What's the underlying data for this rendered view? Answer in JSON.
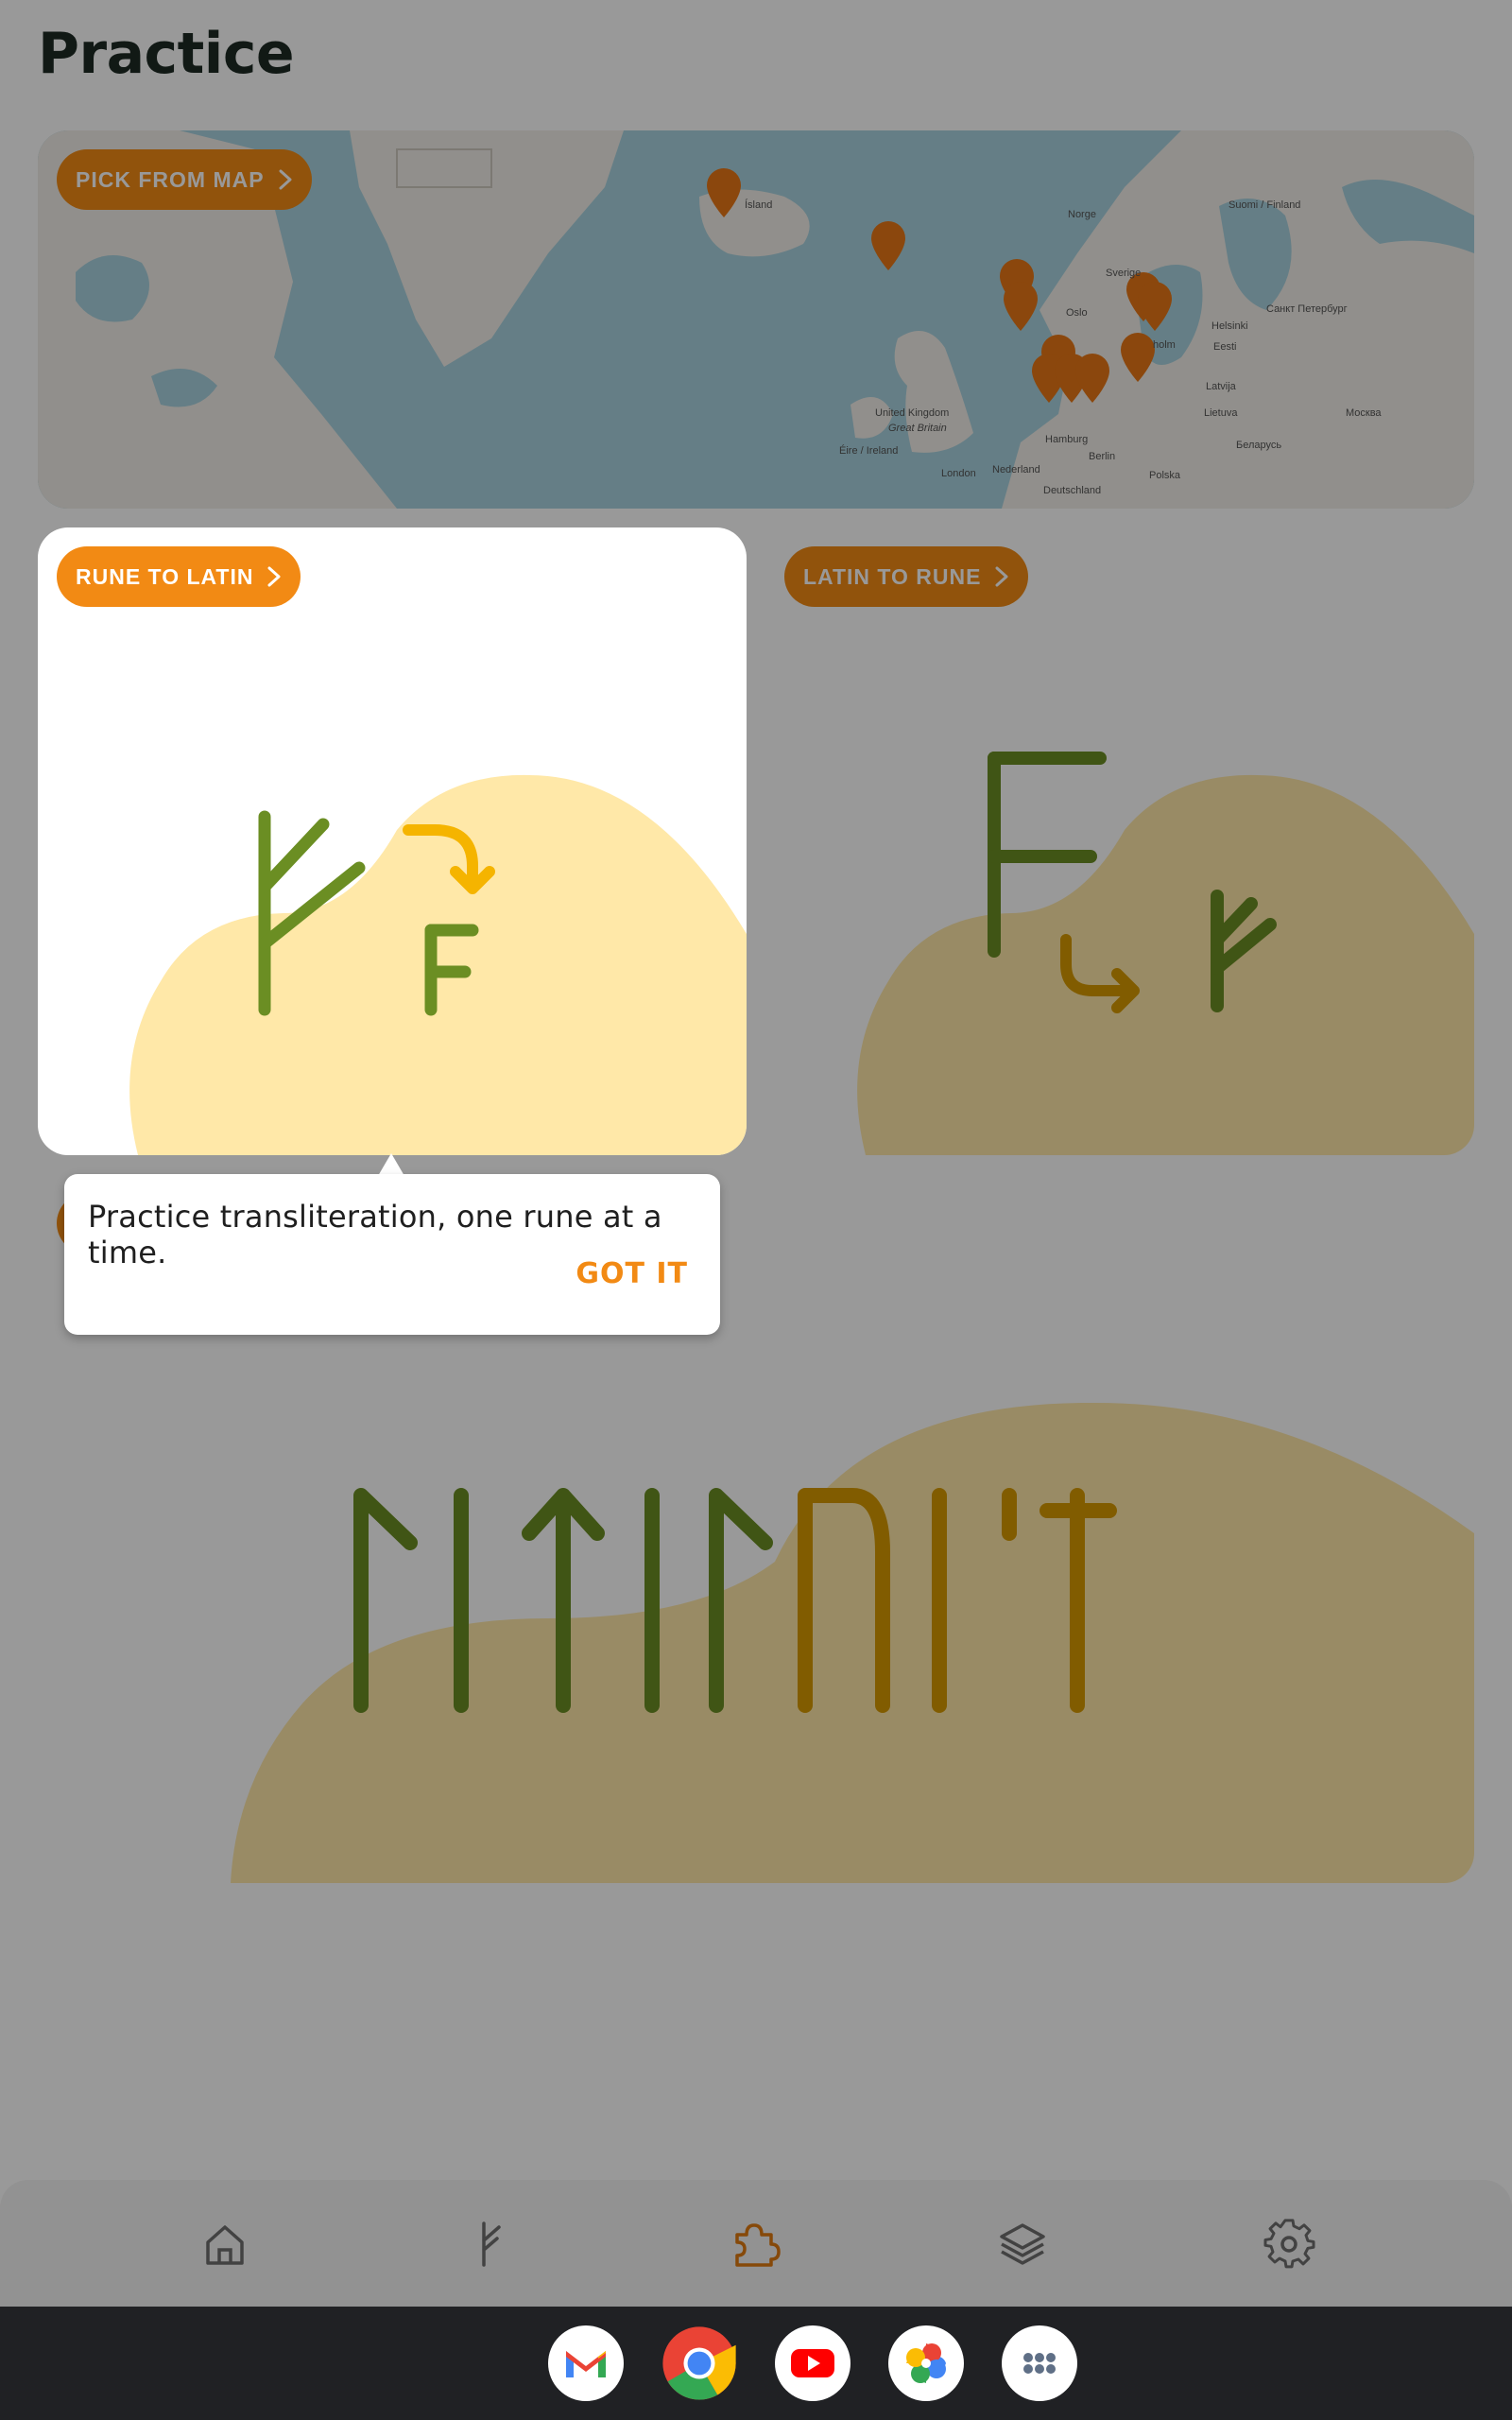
{
  "page": {
    "title": "Practice"
  },
  "map_card": {
    "button_label": "PICK FROM MAP",
    "place_labels": [
      "Ísland",
      "Norge",
      "Sverige",
      "Oslo",
      "Suomi / Finland",
      "Helsinki",
      "Eesti",
      "Latvija",
      "Lietuva",
      "Санкт Петербург",
      "Москва",
      "Беларусь",
      "Polska",
      "Berlin",
      "Hamburg",
      "Deutschland",
      "Nederland",
      "London",
      "United Kingdom",
      "Great Britain",
      "Éire / Ireland",
      "holm"
    ],
    "marker_count": 11,
    "marker_icon": "rune-marker-icon"
  },
  "cards": {
    "rune_to_latin": {
      "label": "RUNE TO LATIN",
      "latin_glyph": "F"
    },
    "latin_to_rune": {
      "label": "LATIN TO RUNE",
      "latin_glyph": "F"
    },
    "words": {
      "glyphs": "ᛚᛁᛏᛁᛚᚢᛁ'ᛏ"
    }
  },
  "tooltip": {
    "text": "Practice transliteration, one rune at a time.",
    "button": "GOT IT"
  },
  "nav": {
    "items": [
      {
        "name": "home",
        "icon": "home-icon",
        "active": false
      },
      {
        "name": "runes",
        "icon": "rune-icon",
        "active": false
      },
      {
        "name": "practice",
        "icon": "puzzle-icon",
        "active": true
      },
      {
        "name": "layers",
        "icon": "layers-icon",
        "active": false
      },
      {
        "name": "settings",
        "icon": "gear-icon",
        "active": false
      }
    ]
  },
  "taskbar": {
    "apps": [
      "gmail-icon",
      "chrome-icon",
      "youtube-icon",
      "photos-icon",
      "app-drawer-icon"
    ]
  },
  "colors": {
    "accent": "#f28a14",
    "rune_green": "#6b8e23",
    "rune_gold": "#d89a00",
    "blob": "#ffe8a8",
    "nav_active": "#e07a10"
  }
}
